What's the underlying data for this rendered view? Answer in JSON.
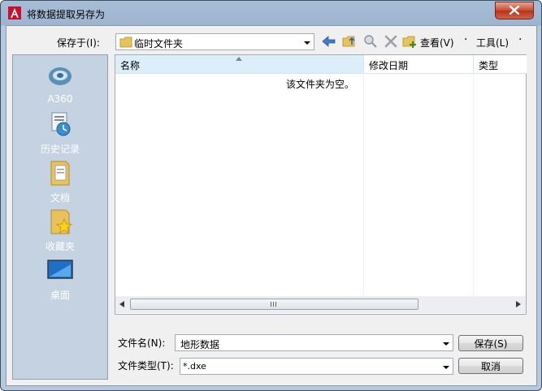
{
  "window": {
    "title": "将数据提取另存为"
  },
  "toolbar": {
    "save_in_label": "保存于(I):",
    "save_in_value": "临时文件夹",
    "view_label": "查看(V)",
    "tools_label": "工具(L)"
  },
  "places": [
    {
      "label": "A360",
      "icon": "a360-cloud-icon"
    },
    {
      "label": "历史记录",
      "icon": "history-icon"
    },
    {
      "label": "文档",
      "icon": "documents-folder-icon"
    },
    {
      "label": "收藏夹",
      "icon": "favorites-folder-icon"
    },
    {
      "label": "桌面",
      "icon": "desktop-icon"
    }
  ],
  "file_list": {
    "columns": [
      "名称",
      "修改日期",
      "类型"
    ],
    "empty_message": "该文件夹为空。"
  },
  "bottom": {
    "filename_label": "文件名(N):",
    "filename_value": "地形数据",
    "filetype_label": "文件类型(T):",
    "filetype_value": "*.dxe",
    "save_button": "保存(S)",
    "cancel_button": "取消"
  },
  "colors": {
    "accent": "#3a6ea5",
    "close": "#c94a32",
    "sidebar": "#c4d2e1"
  }
}
